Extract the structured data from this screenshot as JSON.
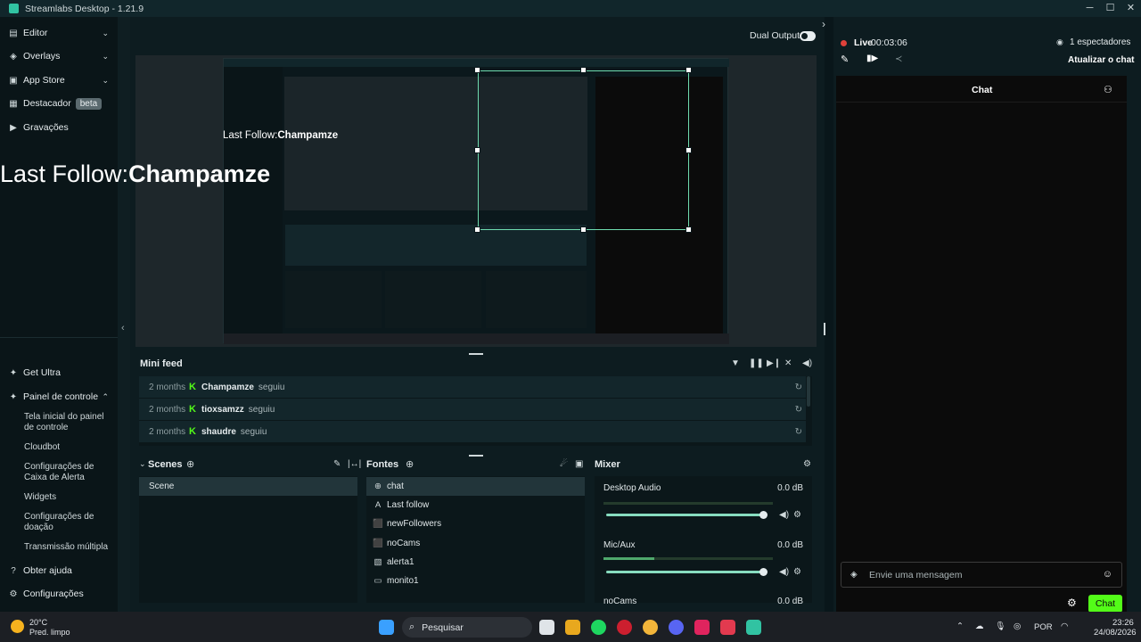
{
  "window": {
    "title": "Streamlabs Desktop - 1.21.9",
    "controls": [
      "─",
      "☐",
      "✕"
    ]
  },
  "sidebar": {
    "items": [
      {
        "label": "Editor",
        "icon": "editor-icon"
      },
      {
        "label": "Overlays",
        "icon": "overlays-icon"
      },
      {
        "label": "App Store",
        "icon": "app-store-icon"
      },
      {
        "label": "Destacador",
        "icon": "highlighter-icon",
        "badge": "beta"
      },
      {
        "label": "Gravações",
        "icon": "recordings-icon"
      }
    ],
    "bottom": {
      "get_ultra": "Get Ultra",
      "dashboard": "Painel de controle",
      "sub_items": [
        "Tela inicial do painel de controle",
        "Cloudbot",
        "Configurações de Caixa de Alerta",
        "Widgets",
        "Configurações de doação",
        "Transmissão múltipla"
      ],
      "help": "Obter ajuda",
      "settings": "Configurações"
    }
  },
  "header": {
    "dual_output": "Dual Output"
  },
  "preview": {
    "last_follow_label": "Last Follow:",
    "last_follow_user": "Champamze"
  },
  "mini_feed": {
    "title": "Mini feed",
    "rows": [
      {
        "ago": "2 months",
        "user": "Champamze",
        "action": "seguiu"
      },
      {
        "ago": "2 months",
        "user": "tioxsamzz",
        "action": "seguiu"
      },
      {
        "ago": "2 months",
        "user": "shaudre",
        "action": "seguiu"
      }
    ]
  },
  "scenes": {
    "title": "Scenes",
    "items": [
      "Scene"
    ]
  },
  "sources": {
    "title": "Fontes",
    "items": [
      {
        "label": "chat",
        "icon": "globe-icon"
      },
      {
        "label": "Last follow",
        "icon": "text-icon"
      },
      {
        "label": "newFollowers",
        "icon": "widget-icon"
      },
      {
        "label": "noCams",
        "icon": "widget-icon"
      },
      {
        "label": "alerta1",
        "icon": "image-icon"
      },
      {
        "label": "monito1",
        "icon": "monitor-icon"
      }
    ]
  },
  "mixer": {
    "title": "Mixer",
    "channels": [
      {
        "name": "Desktop Audio",
        "db": "0.0 dB",
        "level": 0.0,
        "volume": 1.0
      },
      {
        "name": "Mic/Aux",
        "db": "0.0 dB",
        "level": 0.3,
        "volume": 1.0
      },
      {
        "name": "noCams",
        "db": "0.0 dB",
        "level": 0.0,
        "volume": 1.0
      }
    ]
  },
  "right_panel": {
    "live_label": "Live",
    "live_time": "00:03:06",
    "viewers": "1 espectadores",
    "refresh_chat": "Atualizar o chat",
    "chat_title": "Chat",
    "chat_placeholder": "Envie uma mensagem",
    "chat_button": "Chat"
  },
  "taskbar": {
    "weather_temp": "20°C",
    "weather_desc": "Pred. limpo",
    "search_placeholder": "Pesquisar",
    "lang": "POR",
    "time": "23:26",
    "date": "24/08/2026"
  },
  "colors": {
    "accent": "#31c3a2",
    "kick_green": "#53fc18",
    "live_red": "#e0413a"
  }
}
